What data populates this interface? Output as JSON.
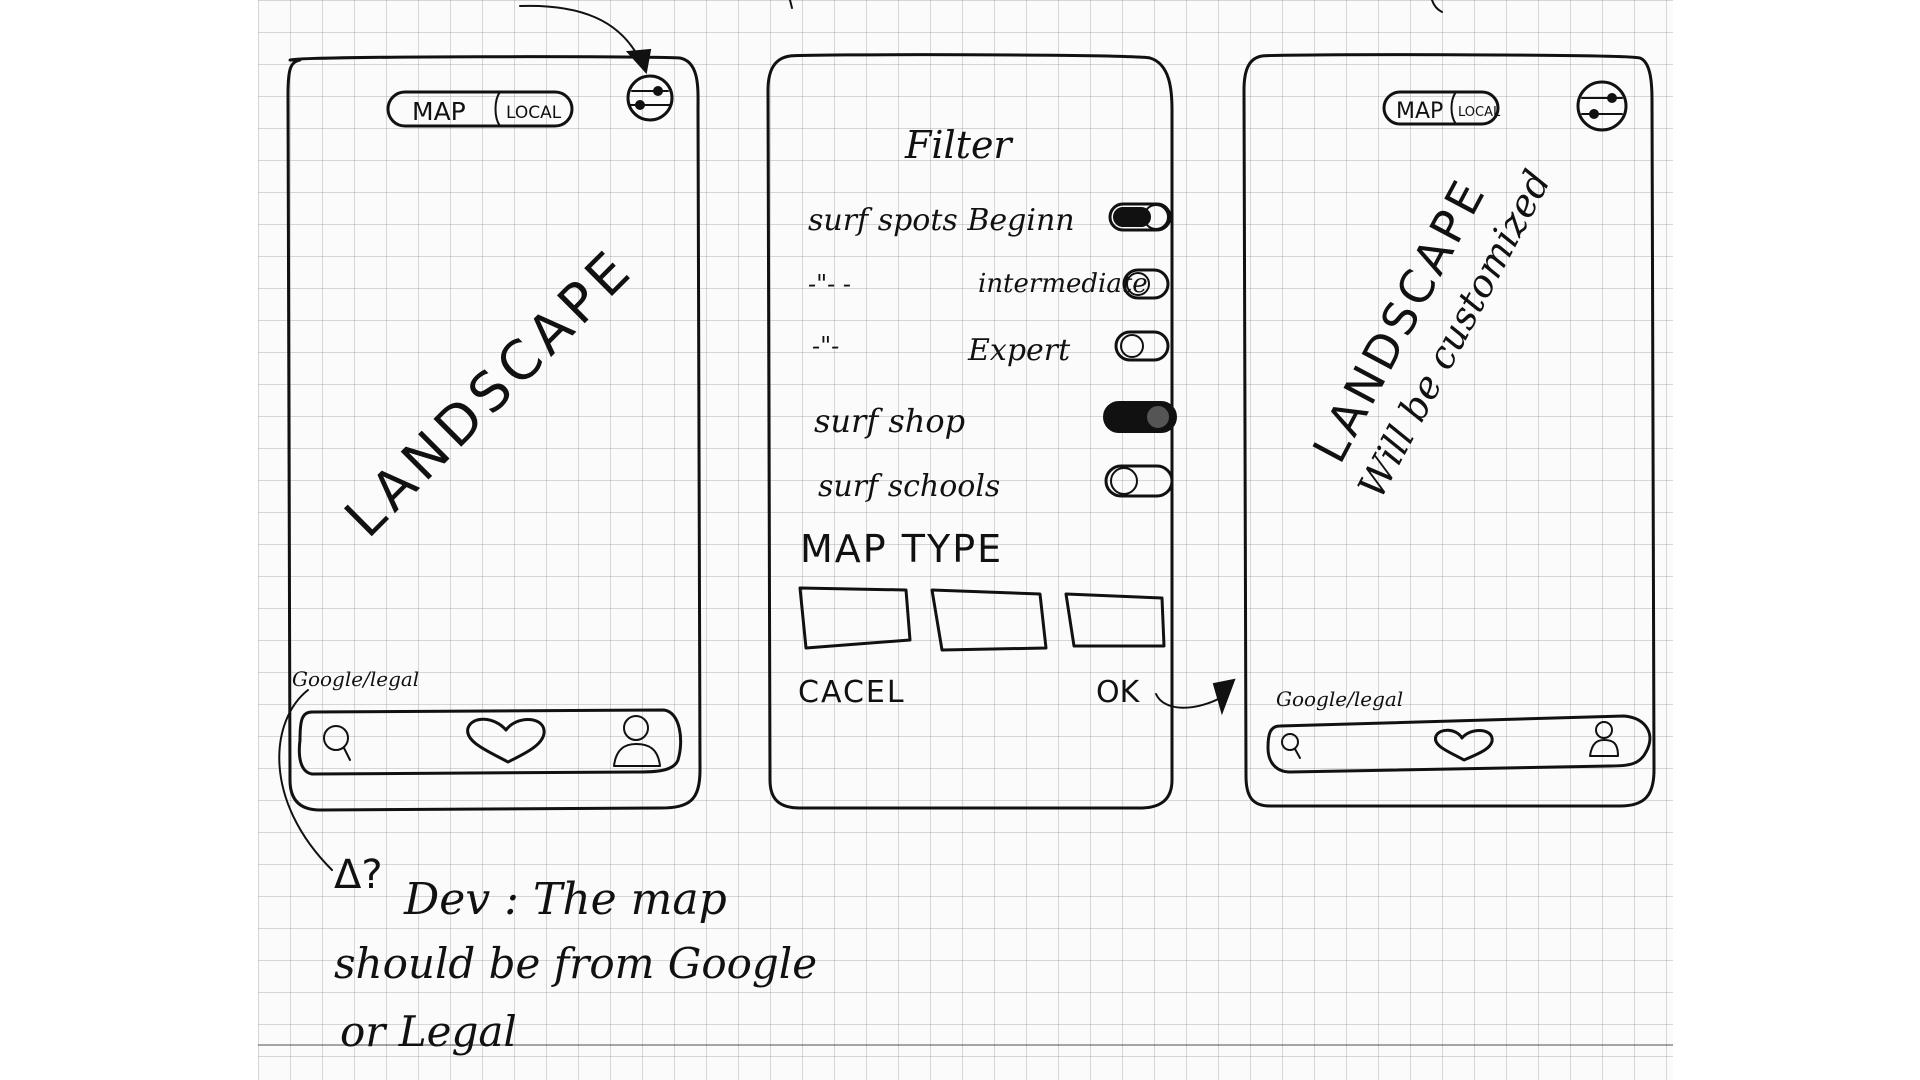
{
  "screen1": {
    "tab_map": "MAP",
    "tab_local": "LOCAL",
    "center_label": "LANDSCAPE",
    "attribution": "Google/legal"
  },
  "screen2": {
    "title": "Filter",
    "filters": [
      {
        "label": "surf spots Beginn",
        "on": true
      },
      {
        "label": "intermediate",
        "prefix": "-\"-   -",
        "on": false
      },
      {
        "label": "Expert",
        "prefix": "-\"-",
        "on": false
      },
      {
        "label": "surf shop",
        "on": true
      },
      {
        "label": "surf schools",
        "on": false
      }
    ],
    "map_type_heading": "MAP TYPE",
    "cancel_label": "CACEL",
    "ok_label": "OK"
  },
  "screen3": {
    "tab_map": "MAP",
    "tab_local": "LOCAL",
    "center_label": "LANDSCAPE",
    "center_sublabel": "Will be customized",
    "attribution": "Google/legal"
  },
  "note": {
    "marker": "Δ?",
    "line1": "Dev : The map",
    "line2": "should be from Google",
    "line3": "or Legal"
  },
  "icons": [
    "filter-sliders-icon",
    "search-icon",
    "heart-icon",
    "profile-icon"
  ]
}
